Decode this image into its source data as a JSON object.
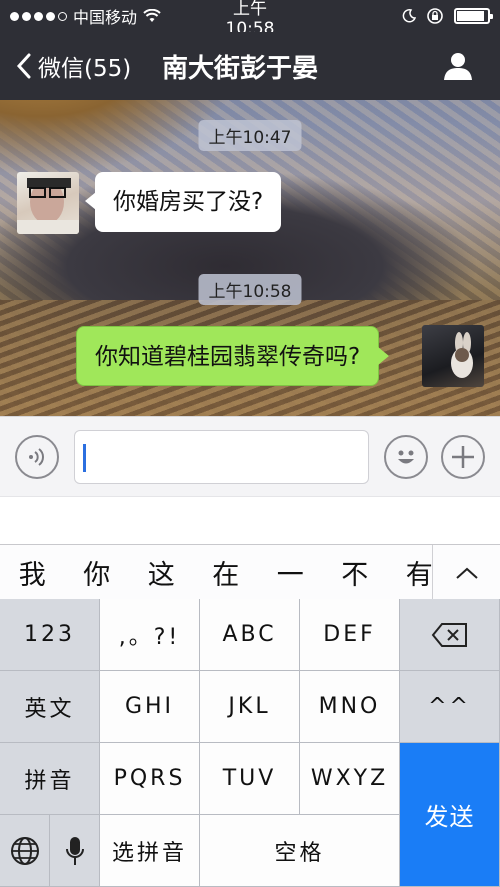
{
  "status_bar": {
    "carrier": "中国移动",
    "time": "上午10:58",
    "battery_level": 0.9
  },
  "nav": {
    "back_label": "微信(55)",
    "title": "南大街彭于晏"
  },
  "messages": [
    {
      "type": "timestamp",
      "text": "上午10:47"
    },
    {
      "type": "incoming",
      "text": "你婚房买了没?"
    },
    {
      "type": "timestamp",
      "text": "上午10:58"
    },
    {
      "type": "outgoing",
      "text": "你知道碧桂园翡翠传奇吗?"
    }
  ],
  "input": {
    "value": ""
  },
  "keyboard": {
    "candidates": [
      "我",
      "你",
      "这",
      "在",
      "一",
      "不",
      "有"
    ],
    "rows": {
      "row1": [
        "123",
        ",。?!",
        "ABC",
        "DEF"
      ],
      "row2": [
        "英文",
        "GHI",
        "JKL",
        "MNO",
        "^^"
      ],
      "row3": [
        "拼音",
        "PQRS",
        "TUV",
        "WXYZ"
      ],
      "row4_select": "选拼音",
      "row4_space": "空格"
    },
    "send_label": "发送"
  },
  "colors": {
    "bar": "#2e2f36",
    "outgoing_bubble": "#a0e75a",
    "send_key": "#1a7df6"
  }
}
